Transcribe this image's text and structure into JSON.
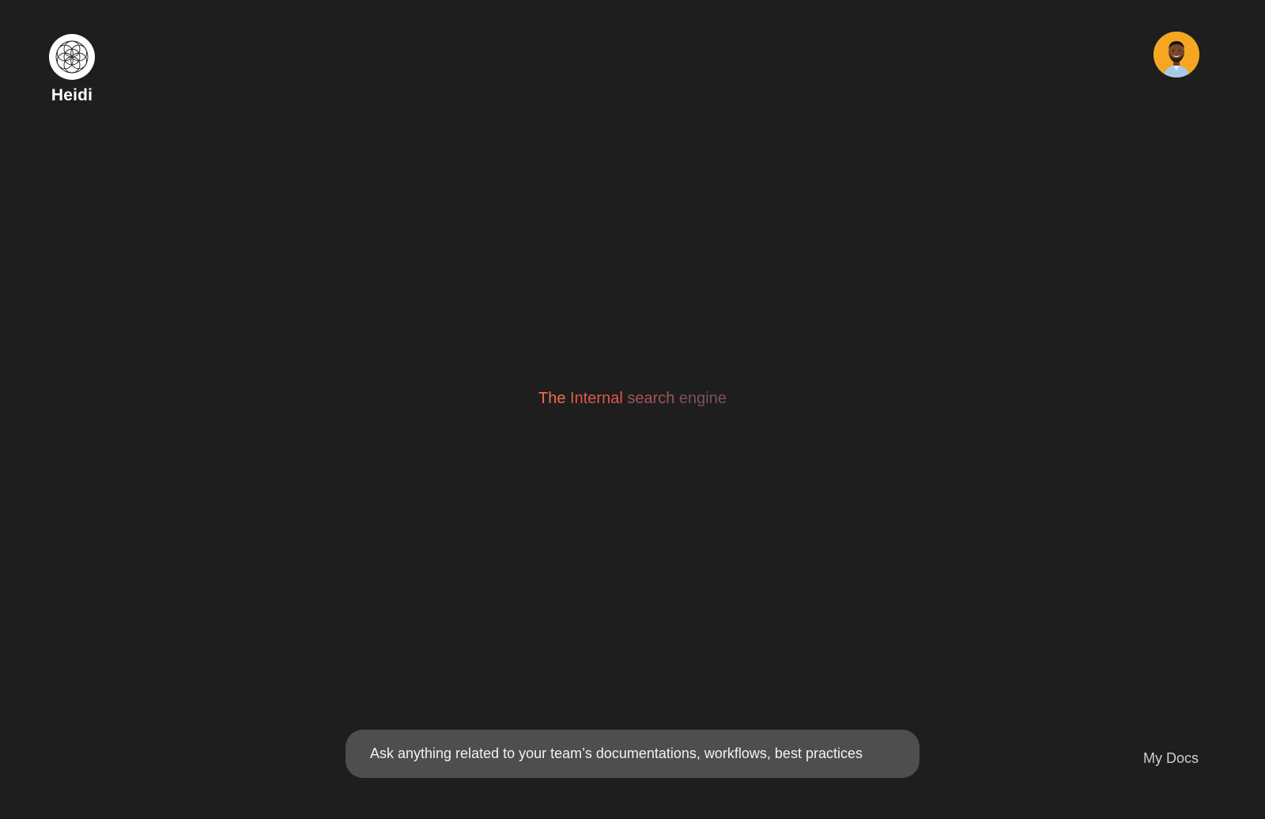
{
  "brand": {
    "name": "Heidi",
    "logo_icon": "flower-of-life-icon"
  },
  "user": {
    "avatar_icon": "user-avatar"
  },
  "tagline": {
    "word1": "The",
    "word2": "Internal",
    "word3": "search",
    "word4": "engine"
  },
  "search": {
    "placeholder": "Ask anything related to your team’s documentations, workflows, best practices",
    "value": ""
  },
  "nav": {
    "docs_label": "My Docs"
  },
  "colors": {
    "background": "#1e1e1e",
    "search_bg": "#4e4e4e",
    "tagline_gradient": [
      "#ef6f4c",
      "#e0564f",
      "#a3545b",
      "#7d5058"
    ],
    "avatar_bg": "#f5a623"
  }
}
